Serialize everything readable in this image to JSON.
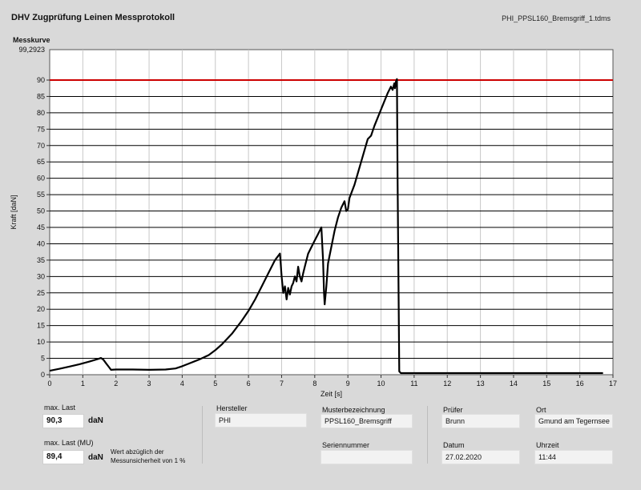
{
  "header": {
    "title": "DHV Zugprüfung Leinen Messprotokoll",
    "filename": "PHI_PPSL160_Bremsgriff_1.tdms",
    "curve_label": "Messkurve"
  },
  "chart_data": {
    "type": "line",
    "xlabel": "Zeit [s]",
    "ylabel": "Kraft [daN]",
    "xlim": [
      0,
      17
    ],
    "ylim": [
      0,
      99.2923
    ],
    "ymax_label": "99,2923",
    "xticks": [
      0,
      1,
      2,
      3,
      4,
      5,
      6,
      7,
      8,
      9,
      10,
      11,
      12,
      13,
      14,
      15,
      16,
      17
    ],
    "yticks": [
      0,
      5,
      10,
      15,
      20,
      25,
      30,
      35,
      40,
      45,
      50,
      55,
      60,
      65,
      70,
      75,
      80,
      85,
      90
    ],
    "grid": true,
    "threshold": {
      "value": 90,
      "color": "#cc0000"
    },
    "series": [
      {
        "color": "#000000",
        "x": [
          0,
          0.3,
          0.6,
          0.9,
          1.2,
          1.45,
          1.55,
          1.62,
          1.7,
          1.8,
          1.85,
          2.0,
          2.5,
          3.0,
          3.5,
          3.8,
          4.0,
          4.2,
          4.5,
          4.8,
          5.0,
          5.2,
          5.5,
          5.8,
          6.0,
          6.2,
          6.4,
          6.6,
          6.8,
          6.95,
          7.0,
          7.05,
          7.1,
          7.15,
          7.2,
          7.25,
          7.3,
          7.35,
          7.4,
          7.45,
          7.5,
          7.55,
          7.6,
          7.65,
          7.7,
          7.75,
          7.8,
          7.9,
          8.0,
          8.1,
          8.2,
          8.25,
          8.28,
          8.3,
          8.35,
          8.4,
          8.5,
          8.6,
          8.7,
          8.8,
          8.9,
          8.95,
          9.0,
          9.05,
          9.2,
          9.4,
          9.6,
          9.7,
          9.8,
          10.0,
          10.2,
          10.3,
          10.35,
          10.4,
          10.42,
          10.45,
          10.48,
          10.5,
          10.55,
          10.6,
          11,
          12,
          13,
          14,
          15,
          16,
          16.7
        ],
        "y": [
          1.2,
          1.8,
          2.5,
          3.2,
          4.0,
          4.8,
          5.1,
          4.6,
          3.5,
          2.2,
          1.5,
          1.6,
          1.6,
          1.5,
          1.6,
          1.9,
          2.6,
          3.4,
          4.6,
          6.0,
          7.5,
          9.3,
          12.5,
          16.5,
          19.5,
          23.0,
          27.0,
          31.0,
          35.0,
          37.0,
          30.0,
          25.0,
          27.0,
          23.0,
          26.5,
          24.5,
          27.0,
          28.0,
          30.0,
          28.5,
          33.0,
          30.0,
          28.5,
          31.0,
          33.0,
          35.0,
          37.0,
          39.0,
          41.0,
          43.0,
          45.0,
          35.0,
          25.0,
          21.5,
          27.0,
          34.0,
          39.0,
          44.0,
          48.0,
          51.0,
          53.0,
          50.0,
          50.5,
          54.0,
          58.0,
          65.0,
          72.0,
          73.0,
          76.0,
          81.0,
          86.0,
          88.0,
          87.0,
          89.0,
          87.5,
          89.5,
          90.3,
          60.0,
          1.0,
          0.5,
          0.5,
          0.5,
          0.5,
          0.5,
          0.5,
          0.5,
          0.5
        ]
      }
    ]
  },
  "fields": {
    "max_last": {
      "label": "max. Last",
      "value": "90,3",
      "unit": "daN"
    },
    "max_last_mu": {
      "label": "max. Last (MU)",
      "value": "89,4",
      "unit": "daN",
      "note_line1": "Wert abzüglich der",
      "note_line2": "Messunsicherheit von 1 %"
    },
    "hersteller": {
      "label": "Hersteller",
      "value": "PHI"
    },
    "musterbezeichnung": {
      "label": "Musterbezeichnung",
      "value": "PPSL160_Bremsgriff"
    },
    "seriennummer": {
      "label": "Seriennummer",
      "value": ""
    },
    "pruefer": {
      "label": "Prüfer",
      "value": "Brunn"
    },
    "datum": {
      "label": "Datum",
      "value": "27.02.2020"
    },
    "ort": {
      "label": "Ort",
      "value": "Gmund am Tegernsee"
    },
    "uhrzeit": {
      "label": "Uhrzeit",
      "value": "11:44"
    }
  }
}
